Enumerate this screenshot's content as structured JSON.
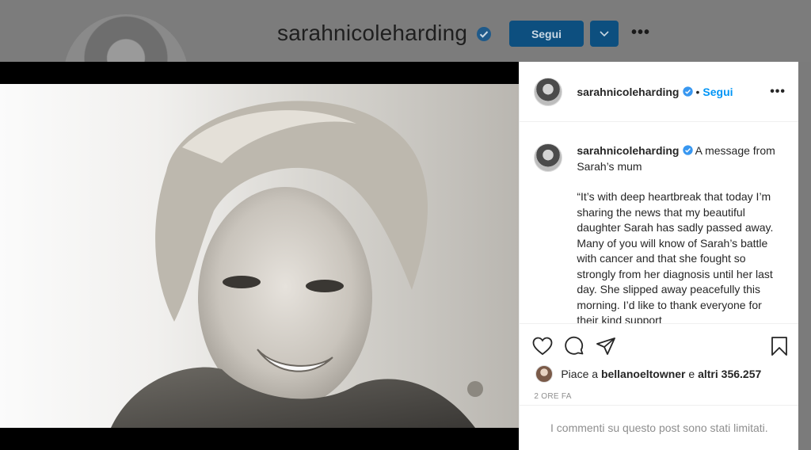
{
  "profile": {
    "username": "sarahnicoleharding",
    "follow_label": "Segui",
    "more_label": "•••"
  },
  "post": {
    "username": "sarahnicoleharding",
    "follow_label": "Segui",
    "more_label": "•••",
    "separator": "•",
    "caption_intro": "A message from Sarah’s mum",
    "caption_body": "“It’s with deep heartbreak that today I’m sharing the news that my beautiful daughter Sarah has sadly passed away. Many of you will know of Sarah’s battle with cancer and that she fought so strongly from her diagnosis until her last day. She slipped away peacefully this morning. I’d like to thank everyone for their kind support",
    "likes_prefix": "Piace a",
    "likes_user": "bellanoeltowner",
    "likes_connector": "e",
    "likes_others": "altri 356.257",
    "timestamp": "2 ORE FA",
    "comments_limited": "I commenti su questo post sono stati limitati."
  },
  "colors": {
    "accent": "#0095f6",
    "verified": "#3897f0",
    "text": "#262626",
    "muted": "#8e8e8e"
  },
  "icons": [
    "heart-icon",
    "comment-icon",
    "share-icon",
    "bookmark-icon",
    "verified-badge-icon",
    "chevron-down-icon",
    "more-icon"
  ]
}
